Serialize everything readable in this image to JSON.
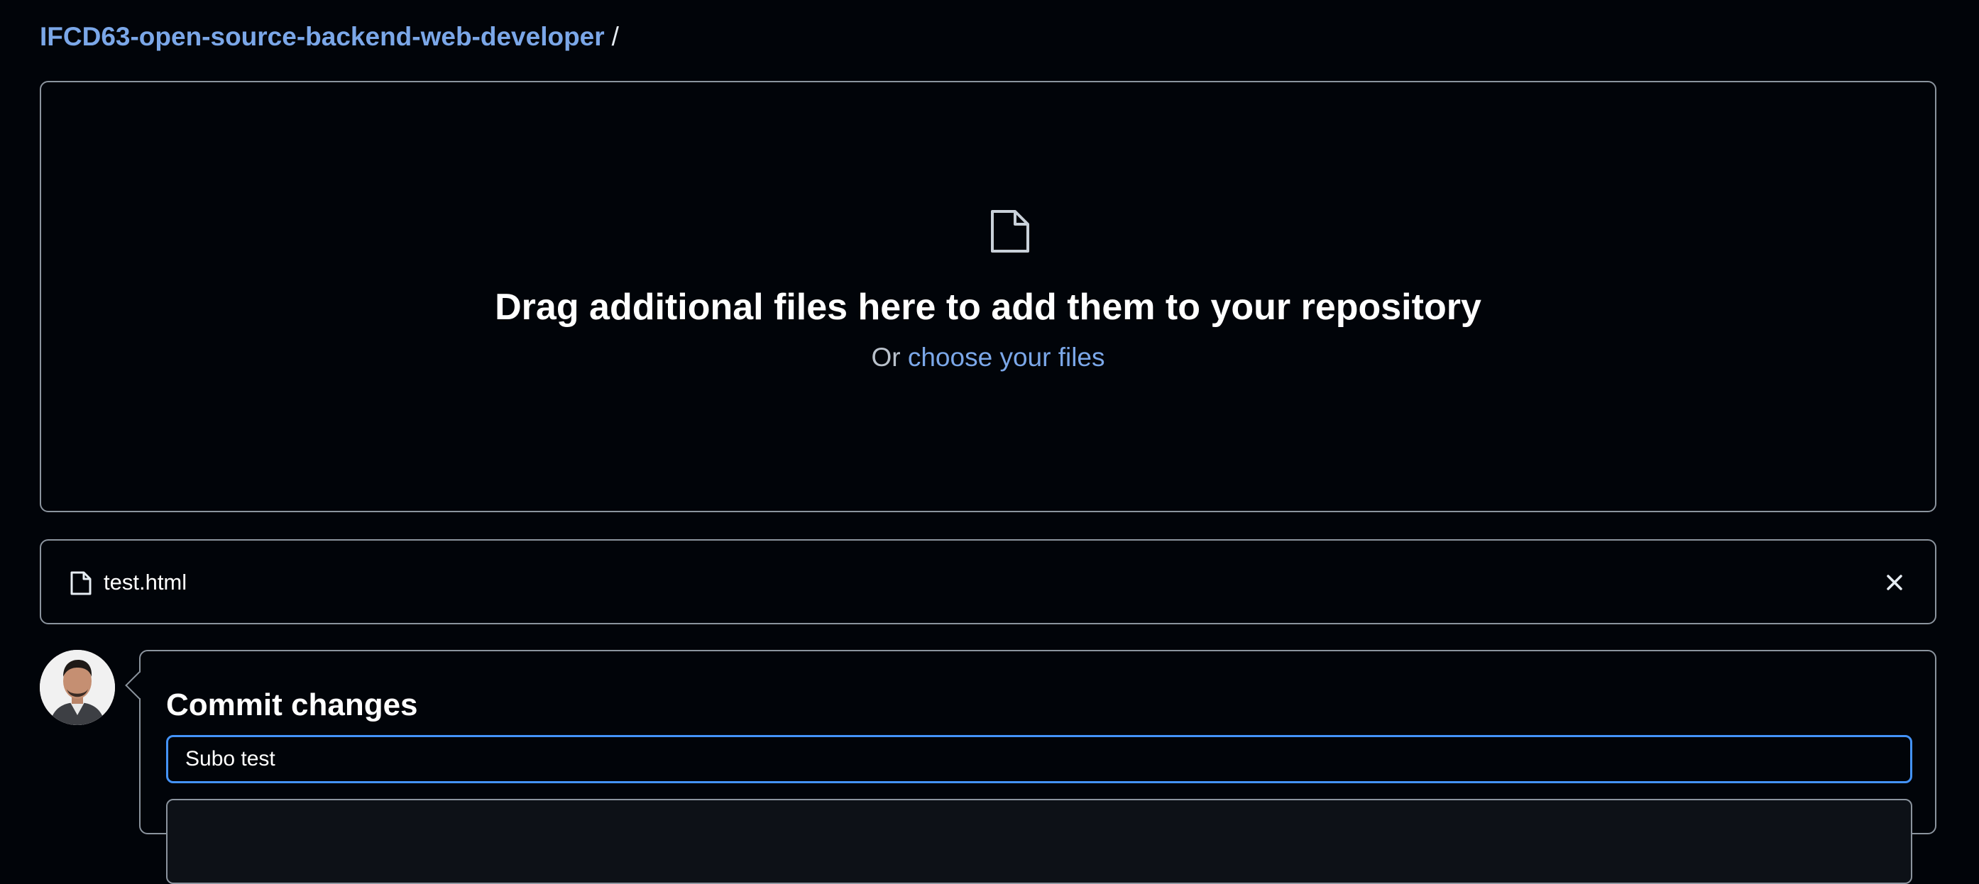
{
  "breadcrumb": {
    "repo": "IFCD63-open-source-backend-web-developer",
    "separator": "/"
  },
  "dropzone": {
    "icon": "file-icon",
    "title": "Drag additional files here to add them to your repository",
    "prefix": "Or",
    "choose_link": "choose your files"
  },
  "upload_list": [
    {
      "icon": "file-icon",
      "name": "test.html",
      "remove_icon": "close-icon"
    }
  ],
  "commit": {
    "title": "Commit changes",
    "message_value": "Subo test",
    "description_value": ""
  },
  "colors": {
    "background": "#010409",
    "link": "#7ba7e8",
    "border": "#8b949e",
    "focus": "#4493f8"
  }
}
